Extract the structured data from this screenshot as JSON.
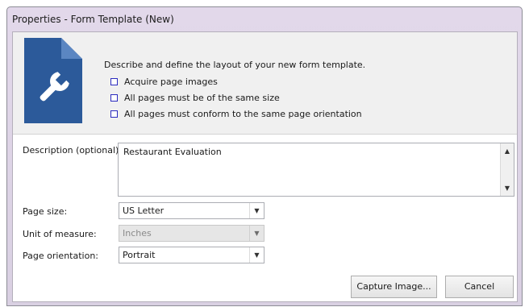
{
  "window": {
    "title": "Properties - Form Template (New)"
  },
  "header": {
    "description": "Describe and define the layout of your new form template.",
    "requirements": [
      "Acquire page images",
      "All pages must be of the same size",
      "All pages must conform to the same page orientation"
    ],
    "icon": "document-wrench-icon",
    "icon_color": "#2c5a9a"
  },
  "fields": {
    "description_label": "Description (optional):",
    "description_value": "Restaurant Evaluation",
    "page_size_label": "Page size:",
    "page_size_value": "US Letter",
    "unit_label": "Unit of measure:",
    "unit_value": "Inches",
    "orientation_label": "Page orientation:",
    "orientation_value": "Portrait"
  },
  "buttons": {
    "capture": "Capture Image...",
    "cancel": "Cancel"
  }
}
